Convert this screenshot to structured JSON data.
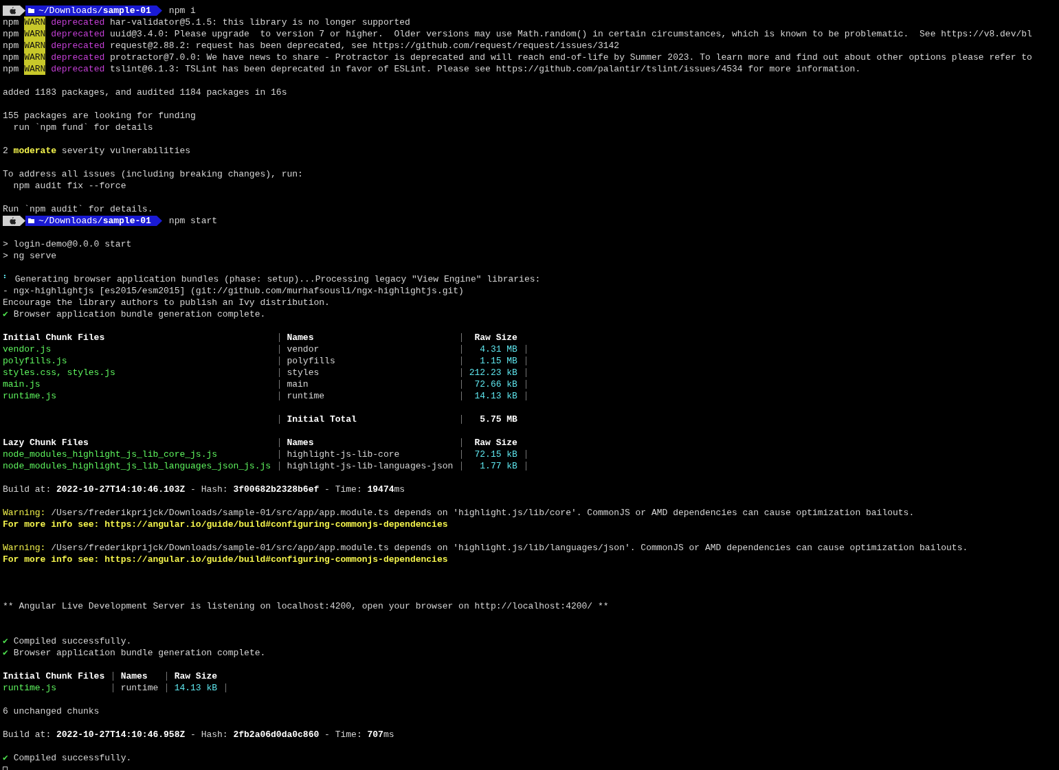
{
  "lines": [
    {
      "kind": "prompt",
      "path": "~/Downloads/**sample-01**",
      "command": "npm i"
    },
    {
      "kind": "text",
      "segments": [
        {
          "text": "npm",
          "kind": "label"
        },
        {
          "text": "WARN",
          "kind": "badge"
        },
        {
          "text": "deprecated",
          "kind": "status"
        },
        {
          "text": "har-validator@5.1.5: this library is no longer supported",
          "kind": "message"
        }
      ]
    },
    {
      "kind": "text",
      "segments": [
        {
          "text": "npm",
          "kind": "label"
        },
        {
          "text": "WARN",
          "kind": "badge"
        },
        {
          "text": "deprecated",
          "kind": "status"
        },
        {
          "text": "uuid@3.4.0: Please upgrade  to version 7 or higher.  Older versions may use Math.random() in certain circumstances, which is known to be problematic.  See https://v8.dev/bl",
          "kind": "message"
        }
      ]
    },
    {
      "kind": "text",
      "segments": [
        {
          "text": "npm",
          "kind": "label"
        },
        {
          "text": "WARN",
          "kind": "badge"
        },
        {
          "text": "deprecated",
          "kind": "status"
        },
        {
          "text": "request@2.88.2: request has been deprecated, see https://github.com/request/request/issues/3142",
          "kind": "message"
        }
      ]
    },
    {
      "kind": "text",
      "segments": [
        {
          "text": "npm",
          "kind": "label"
        },
        {
          "text": "WARN",
          "kind": "badge"
        },
        {
          "text": "deprecated",
          "kind": "status"
        },
        {
          "text": "protractor@7.0.0: We have news to share - Protractor is deprecated and will reach end-of-life by Summer 2023. To learn more and find out about other options please refer to",
          "kind": "message"
        }
      ]
    },
    {
      "kind": "text",
      "segments": [
        {
          "text": "npm",
          "kind": "label"
        },
        {
          "text": "WARN",
          "kind": "badge"
        },
        {
          "text": "deprecated",
          "kind": "status"
        },
        {
          "text": "tslint@6.1.3: TSLint has been deprecated in favor of ESLint. Please see https://github.com/palantir/tslint/issues/4534 for more information.",
          "kind": "message"
        }
      ]
    },
    {
      "kind": "blank"
    },
    {
      "kind": "text",
      "segments": [
        {
          "text": "added 1183 packages, and audited 1184 packages in 16s",
          "kind": "message"
        }
      ]
    },
    {
      "kind": "blank"
    },
    {
      "kind": "text",
      "segments": [
        {
          "text": "155 packages are looking for funding",
          "kind": "message"
        }
      ]
    },
    {
      "kind": "text",
      "segments": [
        {
          "text": "  run `npm fund` for details",
          "kind": "message"
        }
      ]
    },
    {
      "kind": "blank"
    },
    {
      "kind": "text",
      "segments": [
        {
          "text": "2",
          "kind": "message"
        },
        {
          "text": "moderate",
          "kind": "severity"
        },
        {
          "text": "severity vulnerabilities",
          "kind": "message"
        }
      ]
    },
    {
      "kind": "blank"
    },
    {
      "kind": "text",
      "segments": [
        {
          "text": "To address all issues (including breaking changes), run:",
          "kind": "message"
        }
      ]
    },
    {
      "kind": "text",
      "segments": [
        {
          "text": "  npm audit fix --force",
          "kind": "message"
        }
      ]
    },
    {
      "kind": "blank"
    },
    {
      "kind": "text",
      "segments": [
        {
          "text": "Run `npm audit` for details.",
          "kind": "message"
        }
      ]
    },
    {
      "kind": "prompt",
      "path": "~/Downloads/**sample-01**",
      "command": "npm start"
    },
    {
      "kind": "blank"
    },
    {
      "kind": "text",
      "segments": [
        {
          "text": "> login-demo@0.0.0 start",
          "kind": "message"
        }
      ]
    },
    {
      "kind": "text",
      "segments": [
        {
          "text": "> ng serve",
          "kind": "message"
        }
      ]
    },
    {
      "kind": "blank"
    },
    {
      "kind": "text",
      "segments": [
        {
          "text": "⠃",
          "kind": "spinner"
        },
        {
          "text": "Generating browser application bundles (phase: setup)...Processing legacy \"View Engine\" libraries:",
          "kind": "message"
        }
      ]
    },
    {
      "kind": "text",
      "segments": [
        {
          "text": "- ngx-highlightjs [es2015/esm2015] (git://github.com/murhafsousli/ngx-highlightjs.git)",
          "kind": "message"
        }
      ]
    },
    {
      "kind": "text",
      "segments": [
        {
          "text": "Encourage the library authors to publish an Ivy distribution.",
          "kind": "message"
        }
      ]
    },
    {
      "kind": "text",
      "segments": [
        {
          "text": "✔",
          "kind": "check"
        },
        {
          "text": "Browser application bundle generation complete.",
          "kind": "message"
        }
      ]
    },
    {
      "kind": "blank"
    },
    {
      "kind": "table",
      "rows": [
        {
          "kind": "header",
          "cells": [
            "Initial Chunk Files",
            "Names",
            "Raw Size"
          ]
        },
        {
          "kind": "file",
          "cells": [
            "vendor.js",
            "vendor",
            "4.31 MB"
          ]
        },
        {
          "kind": "file",
          "cells": [
            "polyfills.js",
            "polyfills",
            "1.15 MB"
          ]
        },
        {
          "kind": "file",
          "cells": [
            "styles.css, styles.js",
            "styles",
            "212.23 kB"
          ]
        },
        {
          "kind": "file",
          "cells": [
            "main.js",
            "main",
            "72.66 kB"
          ]
        },
        {
          "kind": "file",
          "cells": [
            "runtime.js",
            "runtime",
            "14.13 kB"
          ]
        },
        {
          "kind": "gap"
        },
        {
          "kind": "total",
          "cells": [
            "Initial Total",
            "5.75 MB"
          ]
        },
        {
          "kind": "gap"
        },
        {
          "kind": "header",
          "cells": [
            "Lazy Chunk Files",
            "Names",
            "Raw Size"
          ]
        },
        {
          "kind": "file",
          "cells": [
            "node_modules_highlight_js_lib_core_js.js",
            "highlight-js-lib-core",
            "72.15 kB"
          ]
        },
        {
          "kind": "file",
          "cells": [
            "node_modules_highlight_js_lib_languages_json_js.js",
            "highlight-js-lib-languages-json",
            "1.77 kB"
          ]
        }
      ]
    },
    {
      "kind": "blank"
    },
    {
      "kind": "text",
      "segments": [
        {
          "text": "Build at:",
          "kind": "message"
        },
        {
          "text": "2022-10-27T14:10:46.103Z",
          "kind": "value"
        },
        {
          "text": "- Hash:",
          "kind": "message"
        },
        {
          "text": "3f00682b2328b6ef",
          "kind": "value"
        },
        {
          "text": "- Time:",
          "kind": "message"
        },
        {
          "text": "19474",
          "kind": "value"
        },
        {
          "text": "ms",
          "kind": "unit"
        }
      ]
    },
    {
      "kind": "blank"
    },
    {
      "kind": "text",
      "segments": [
        {
          "text": "Warning:",
          "kind": "warning"
        },
        {
          "text": "/Users/frederikprijck/Downloads/sample-01/src/app/app.module.ts depends on 'highlight.js/lib/core'. CommonJS or AMD dependencies can cause optimization bailouts.",
          "kind": "message"
        }
      ]
    },
    {
      "kind": "text",
      "segments": [
        {
          "text": "For more info see: https://angular.io/guide/build#configuring-commonjs-dependencies",
          "kind": "info"
        }
      ]
    },
    {
      "kind": "blank"
    },
    {
      "kind": "text",
      "segments": [
        {
          "text": "Warning:",
          "kind": "warning"
        },
        {
          "text": "/Users/frederikprijck/Downloads/sample-01/src/app/app.module.ts depends on 'highlight.js/lib/languages/json'. CommonJS or AMD dependencies can cause optimization bailouts.",
          "kind": "message"
        }
      ]
    },
    {
      "kind": "text",
      "segments": [
        {
          "text": "For more info see: https://angular.io/guide/build#configuring-commonjs-dependencies",
          "kind": "info"
        }
      ]
    },
    {
      "kind": "blank"
    },
    {
      "kind": "blank"
    },
    {
      "kind": "blank"
    },
    {
      "kind": "text",
      "segments": [
        {
          "text": "** Angular Live Development Server is listening on localhost:4200, open your browser on http://localhost:4200/ **",
          "kind": "message"
        }
      ]
    },
    {
      "kind": "blank"
    },
    {
      "kind": "blank"
    },
    {
      "kind": "text",
      "segments": [
        {
          "text": "✔",
          "kind": "check"
        },
        {
          "text": "Compiled successfully.",
          "kind": "message"
        }
      ]
    },
    {
      "kind": "text",
      "segments": [
        {
          "text": "✔",
          "kind": "check"
        },
        {
          "text": "Browser application bundle generation complete.",
          "kind": "message"
        }
      ]
    },
    {
      "kind": "blank"
    },
    {
      "kind": "table",
      "rows": [
        {
          "kind": "header",
          "cells": [
            "Initial Chunk Files",
            "Names",
            "Raw Size"
          ]
        },
        {
          "kind": "file",
          "cells": [
            "runtime.js",
            "runtime",
            "14.13 kB"
          ]
        }
      ]
    },
    {
      "kind": "blank"
    },
    {
      "kind": "text",
      "segments": [
        {
          "text": "6 unchanged chunks",
          "kind": "message"
        }
      ]
    },
    {
      "kind": "blank"
    },
    {
      "kind": "text",
      "segments": [
        {
          "text": "Build at:",
          "kind": "message"
        },
        {
          "text": "2022-10-27T14:10:46.958Z",
          "kind": "value"
        },
        {
          "text": "- Hash:",
          "kind": "message"
        },
        {
          "text": "2fb2a06d0da0c860",
          "kind": "value"
        },
        {
          "text": "- Time:",
          "kind": "message"
        },
        {
          "text": "707",
          "kind": "value"
        },
        {
          "text": "ms",
          "kind": "unit"
        }
      ]
    },
    {
      "kind": "blank"
    },
    {
      "kind": "text",
      "segments": [
        {
          "text": "✔",
          "kind": "check"
        },
        {
          "text": "Compiled successfully.",
          "kind": "message"
        }
      ]
    },
    {
      "kind": "cursor"
    }
  ]
}
